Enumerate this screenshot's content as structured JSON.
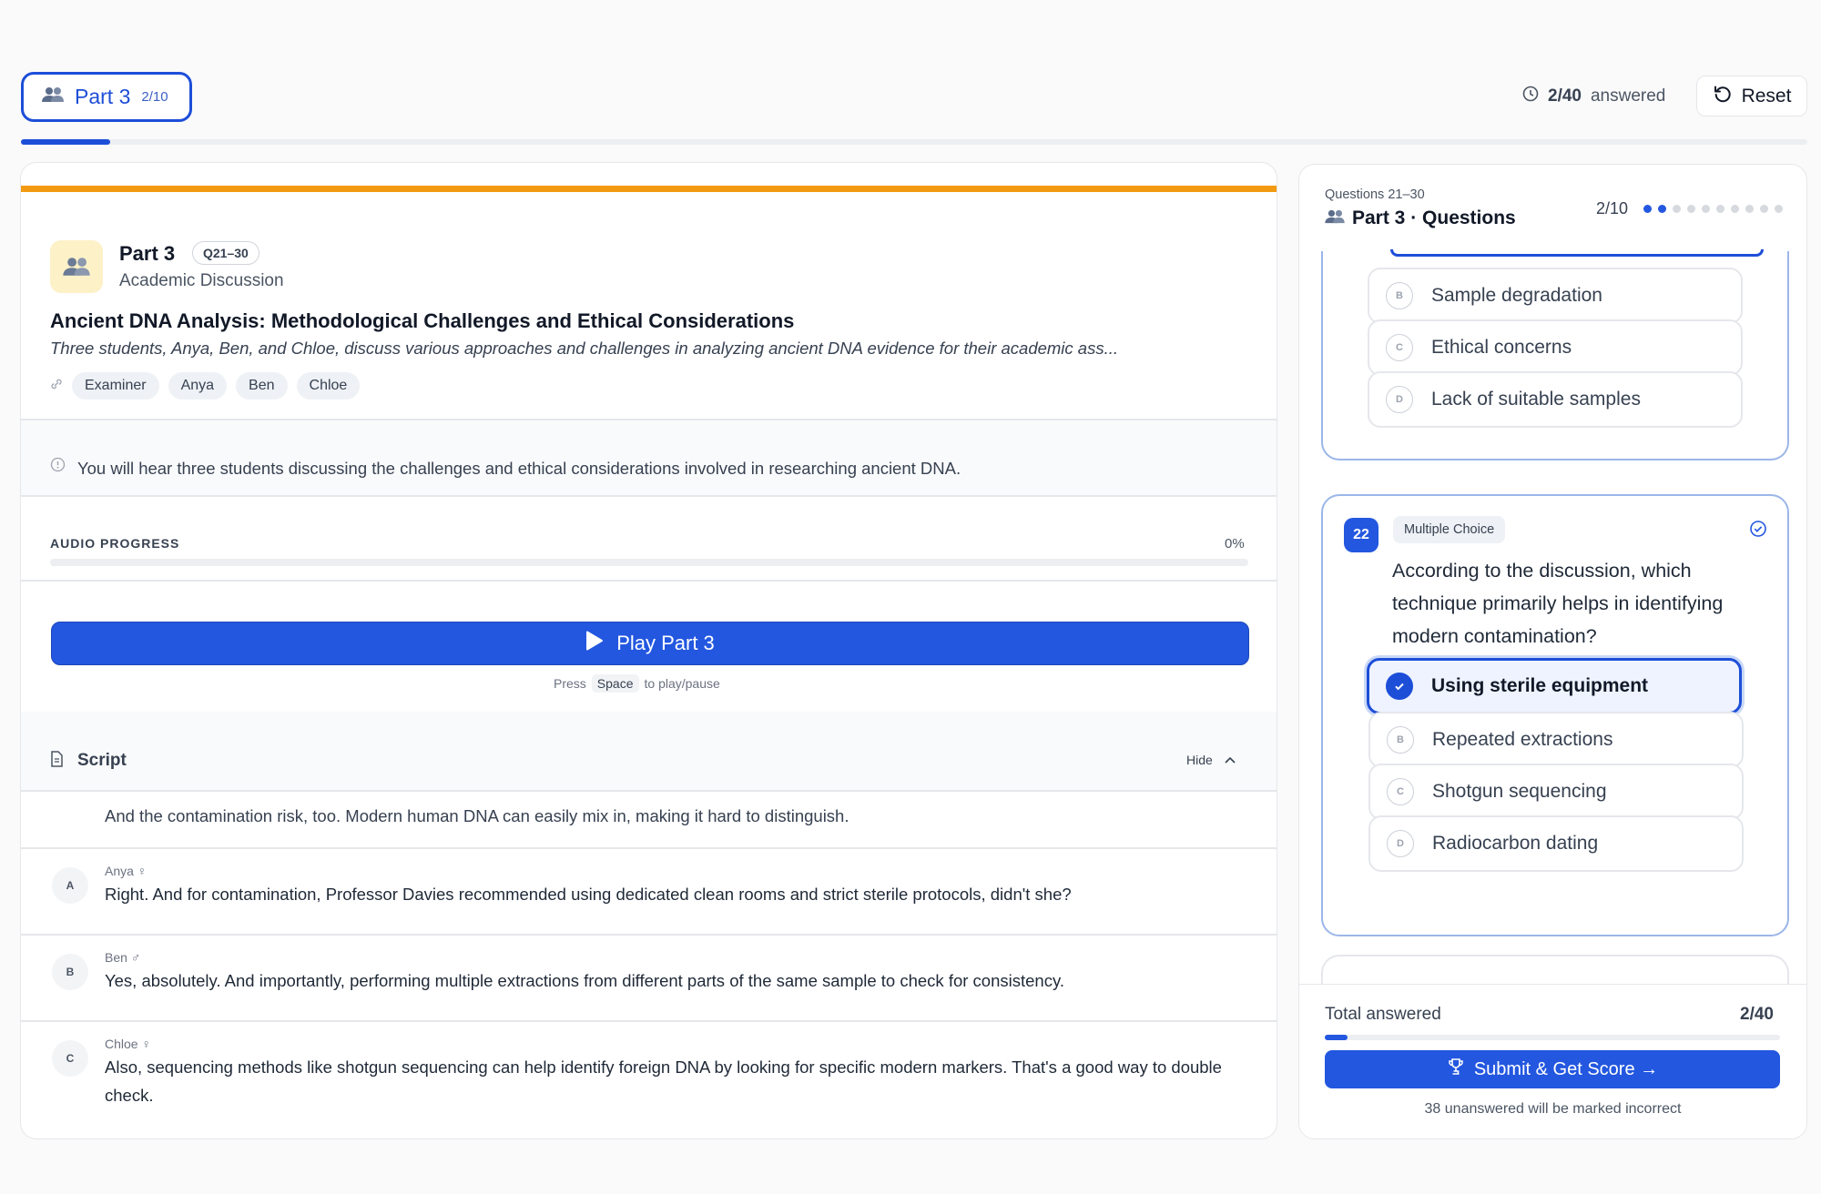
{
  "header": {
    "part_label": "Part 3",
    "part_progress": "2/10",
    "part_progress_fraction": 0.05,
    "answered_count": "2/40",
    "answered_suffix": "answered",
    "reset_label": "Reset"
  },
  "part": {
    "title": "Part 3",
    "badge": "Q21–30",
    "subtitle": "Academic Discussion",
    "topic": "Ancient DNA Analysis: Methodological Challenges and Ethical Considerations",
    "description": "Three students, Anya, Ben, and Chloe, discuss various approaches and challenges in analyzing ancient DNA evidence for their academic ass...",
    "speakers": [
      "Examiner",
      "Anya",
      "Ben",
      "Chloe"
    ]
  },
  "intro": "You will hear three students discussing the challenges and ethical considerations involved in researching ancient DNA.",
  "audio": {
    "label": "AUDIO PROGRESS",
    "percent": "0%",
    "progress_fraction": 0,
    "play_label": "Play Part 3",
    "hint_prefix": "Press",
    "hint_key": "Space",
    "hint_suffix": "to play/pause"
  },
  "script": {
    "title": "Script",
    "hide_label": "Hide",
    "partial_line": "And the contamination risk, too. Modern human DNA can easily mix in, making it hard to distinguish.",
    "turns": [
      {
        "initial": "A",
        "speaker": "Anya ♀",
        "text": "Right. And for contamination, Professor Davies recommended using dedicated clean rooms and strict sterile protocols, didn't she?"
      },
      {
        "initial": "B",
        "speaker": "Ben ♂",
        "text": "Yes, absolutely. And importantly, performing multiple extractions from different parts of the same sample to check for consistency."
      },
      {
        "initial": "C",
        "speaker": "Chloe ♀",
        "text": "Also, sequencing methods like shotgun sequencing can help identify foreign DNA by looking for specific modern markers. That's a good way to double check."
      }
    ]
  },
  "panel": {
    "range": "Questions 21–30",
    "title": "Part 3 · Questions",
    "count": "2/10",
    "q21_options": [
      {
        "letter": "B",
        "text": "Sample degradation"
      },
      {
        "letter": "C",
        "text": "Ethical concerns"
      },
      {
        "letter": "D",
        "text": "Lack of suitable samples"
      }
    ],
    "q22": {
      "number": "22",
      "type": "Multiple Choice",
      "text": "According to the discussion, which technique primarily helps in identifying modern contamination?",
      "options": [
        {
          "letter": "A",
          "text": "Using sterile equipment",
          "selected": true
        },
        {
          "letter": "B",
          "text": "Repeated extractions"
        },
        {
          "letter": "C",
          "text": "Shotgun sequencing"
        },
        {
          "letter": "D",
          "text": "Radiocarbon dating"
        }
      ]
    },
    "total_label": "Total answered",
    "total_value": "2/40",
    "total_fraction": 0.05,
    "submit_label": "Submit & Get Score →",
    "submit_note": "38 unanswered will be marked incorrect"
  },
  "colors": {
    "accent": "#2357e0",
    "part_accent": "#f29a12"
  }
}
